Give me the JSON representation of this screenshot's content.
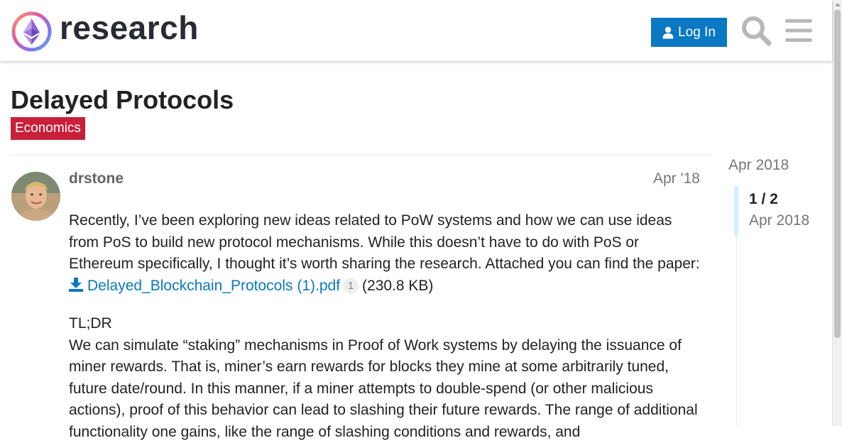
{
  "header": {
    "site_name": "research",
    "login_label": "Log In"
  },
  "topic": {
    "title": "Delayed Protocols",
    "category": "Economics",
    "category_color": "#c8203a"
  },
  "post": {
    "username": "drstone",
    "date": "Apr '18",
    "para1_text": "Recently, I’ve been exploring new ideas related to PoW systems and how we can use ideas from PoS to build new protocol mechanisms. While this doesn’t have to do with PoS or Ethereum specifically, I thought it’s worth sharing the research. Attached you can find the paper: ",
    "attachment_name": "Delayed_Blockchain_Protocols (1).pdf",
    "attachment_clicks": "1",
    "attachment_size": "(230.8 KB)",
    "tldr_label": "TL;DR",
    "tldr_text": "We can simulate “staking” mechanisms in Proof of Work systems by delaying the issuance of miner rewards. That is, miner’s earn rewards for blocks they mine at some arbitrarily tuned, future date/round. In this manner, if a miner attempts to double-spend (or other malicious actions), proof of this behavior can lead to slashing their future rewards. The range of additional functionality one gains, like the range of slashing conditions and rewards, and"
  },
  "timeline": {
    "top_date": "Apr 2018",
    "count": "1 / 2",
    "current_date": "Apr 2018"
  },
  "colors": {
    "accent": "#0a78c2",
    "header_text": "#2a2a33"
  }
}
